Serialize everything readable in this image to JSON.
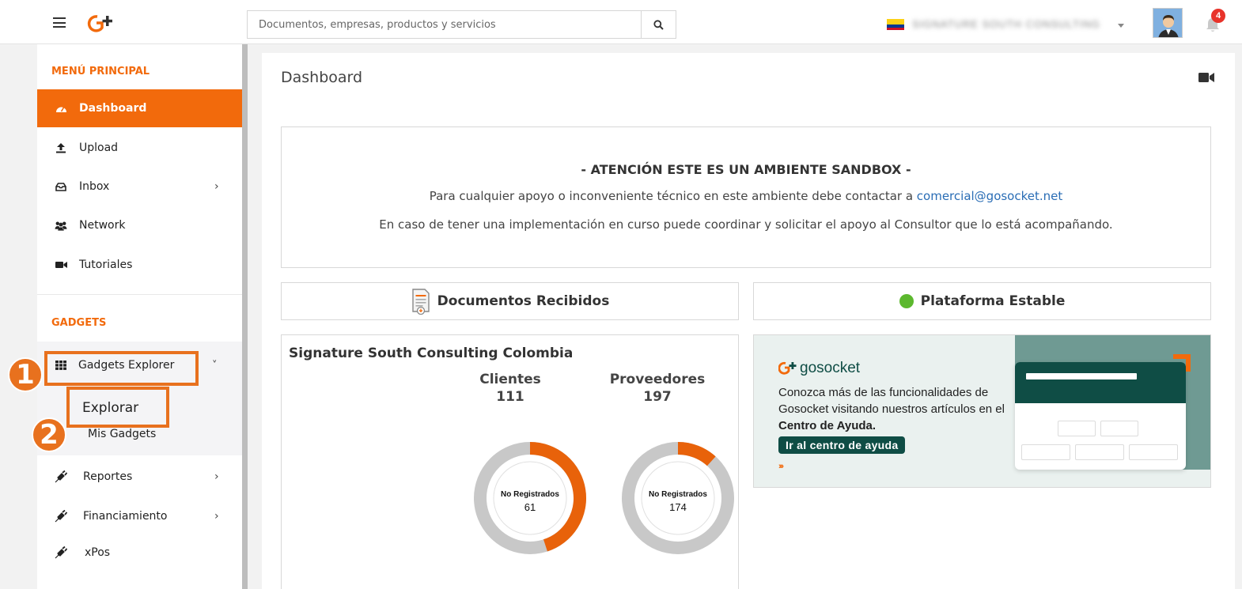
{
  "topbar": {
    "search_placeholder": "Documentos, empresas, productos y servicios",
    "company_name": "SIGNATURE SOUTH CONSULTING",
    "notifications_count": "4"
  },
  "sidebar": {
    "main_title": "MENÚ PRINCIPAL",
    "items": [
      {
        "label": "Dashboard",
        "icon": "dashboard-icon"
      },
      {
        "label": "Upload",
        "icon": "upload-icon"
      },
      {
        "label": "Inbox",
        "icon": "inbox-icon",
        "chevron": "›"
      },
      {
        "label": "Network",
        "icon": "network-icon"
      },
      {
        "label": "Tutoriales",
        "icon": "video-camera-icon"
      }
    ],
    "gadgets_title": "GADGETS",
    "gadgets_explorer": "Gadgets Explorer",
    "gadgets_chevron": "˅",
    "explorar": "Explorar",
    "mis_gadgets": "Mis Gadgets",
    "tools": [
      {
        "label": "Reportes",
        "chevron": "›"
      },
      {
        "label": "Financiamiento",
        "chevron": "›"
      },
      {
        "label": "xPos"
      }
    ]
  },
  "steps": {
    "one": "1",
    "two": "2"
  },
  "main": {
    "title": "Dashboard",
    "notice": {
      "title": "- ATENCIÓN ESTE ES UN AMBIENTE SANDBOX -",
      "line1_prefix": "Para cualquier apoyo o inconveniente técnico en este ambiente debe contactar a",
      "line1_email": "comercial@gosocket.net",
      "line2": "En caso de tener una implementación en curso puede coordinar y solicitar el apoyo al Consultor que lo está acompañando."
    },
    "received_title": "Documentos Recibidos",
    "platform_title": "Plataforma Estable",
    "stats": {
      "company": "Signature South Consulting Colombia",
      "clientes": {
        "label": "Clientes",
        "total": "111",
        "center_label": "No Registrados",
        "center_value": "61",
        "unregistered_share": 0.55
      },
      "proveedores": {
        "label": "Proveedores",
        "total": "197",
        "center_label": "No Registrados",
        "center_value": "174",
        "unregistered_share": 0.883
      }
    },
    "promo": {
      "brand": "gosocket",
      "text_prefix": "Conozca más de las funcionalidades de Gosocket visitando nuestros artículos en el",
      "text_bold": "Centro de Ayuda.",
      "button": "Ir al centro de ayuda",
      "arrows": "›››"
    }
  },
  "colors": {
    "accent": "#f26a0c",
    "donut_registered": "#e8620a",
    "donut_unregistered": "#c8c8c8",
    "status_ok": "#5cb82e",
    "promo_dark": "#0f4d45"
  }
}
